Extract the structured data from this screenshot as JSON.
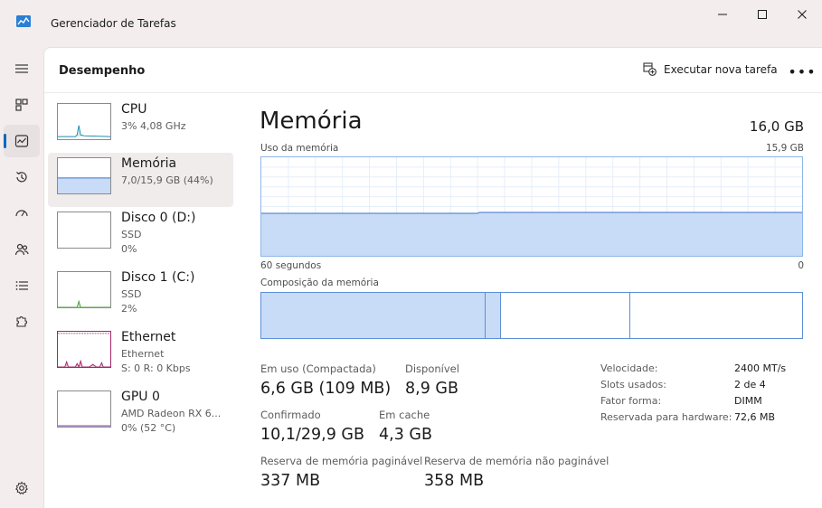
{
  "window": {
    "title": "Gerenciador de Tarefas"
  },
  "header": {
    "title": "Desempenho",
    "new_task_label": "Executar nova tarefa",
    "more_label": "•••"
  },
  "perf_items": [
    {
      "name": "CPU",
      "line1": "3% 4,08 GHz",
      "line2": ""
    },
    {
      "name": "Memória",
      "line1": "7,0/15,9 GB (44%)",
      "line2": ""
    },
    {
      "name": "Disco 0 (D:)",
      "line1": "SSD",
      "line2": "0%"
    },
    {
      "name": "Disco 1 (C:)",
      "line1": "SSD",
      "line2": "2%"
    },
    {
      "name": "Ethernet",
      "line1": "Ethernet",
      "line2": "S: 0 R: 0 Kbps"
    },
    {
      "name": "GPU 0",
      "line1": "AMD Radeon RX 6...",
      "line2": "0% (52 °C)"
    }
  ],
  "detail": {
    "title": "Memória",
    "total": "16,0 GB",
    "usage_label": "Uso da memória",
    "usage_max": "15,9 GB",
    "time_left": "60 segundos",
    "time_right": "0",
    "composition_label": "Composição da memória",
    "composition": [
      {
        "name": "in-use",
        "fraction": 0.415
      },
      {
        "name": "modified",
        "fraction": 0.028
      },
      {
        "name": "standby",
        "fraction": 0.24
      },
      {
        "name": "free",
        "fraction": 0.317
      }
    ],
    "usage_fraction": 0.44,
    "stats": {
      "in_use_label": "Em uso (Compactada)",
      "in_use_value": "6,6 GB (109 MB)",
      "available_label": "Disponível",
      "available_value": "8,9 GB",
      "committed_label": "Confirmado",
      "committed_value": "10,1/29,9 GB",
      "cached_label": "Em cache",
      "cached_value": "4,3 GB",
      "paged_label": "Reserva de memória paginável",
      "paged_value": "337 MB",
      "nonpaged_label": "Reserva de memória não paginável",
      "nonpaged_value": "358 MB"
    },
    "specs": [
      {
        "label": "Velocidade:",
        "value": "2400 MT/s"
      },
      {
        "label": "Slots usados:",
        "value": "2 de 4"
      },
      {
        "label": "Fator forma:",
        "value": "DIMM"
      },
      {
        "label": "Reservada para hardware:",
        "value": "72,6 MB"
      }
    ]
  },
  "colors": {
    "memory_fill": "#c9dcf7",
    "memory_line": "#3d73c8",
    "accent": "#0067c0",
    "ethernet": "#a4266a",
    "cpu": "#1a8cb0",
    "disk": "#4c9e3c",
    "gpu": "#7c4fb0"
  }
}
